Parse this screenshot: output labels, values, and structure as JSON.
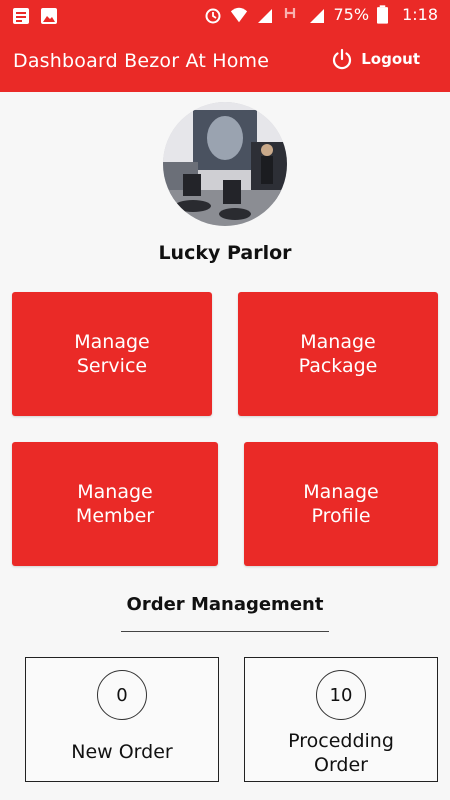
{
  "status_bar": {
    "battery": "75%",
    "time": "1:18",
    "icons": [
      "notes-icon",
      "image-icon",
      "alarm-icon",
      "wifi-icon",
      "signal-icon",
      "h-icon",
      "signal-icon",
      "battery-icon"
    ]
  },
  "app_bar": {
    "title": "Dashboard Bezor At Home",
    "logout_label": "Logout",
    "color": "#ea2a27"
  },
  "profile": {
    "name": "Lucky Parlor"
  },
  "tiles": [
    {
      "label": "Manage\nService"
    },
    {
      "label": "Manage\nPackage"
    },
    {
      "label": "Manage\nMember"
    },
    {
      "label": "Manage\nProfile"
    }
  ],
  "order_management": {
    "title": "Order Management",
    "cards": [
      {
        "count": "0",
        "label": "New Order"
      },
      {
        "count": "10",
        "label": "Procedding\nOrder"
      }
    ]
  }
}
